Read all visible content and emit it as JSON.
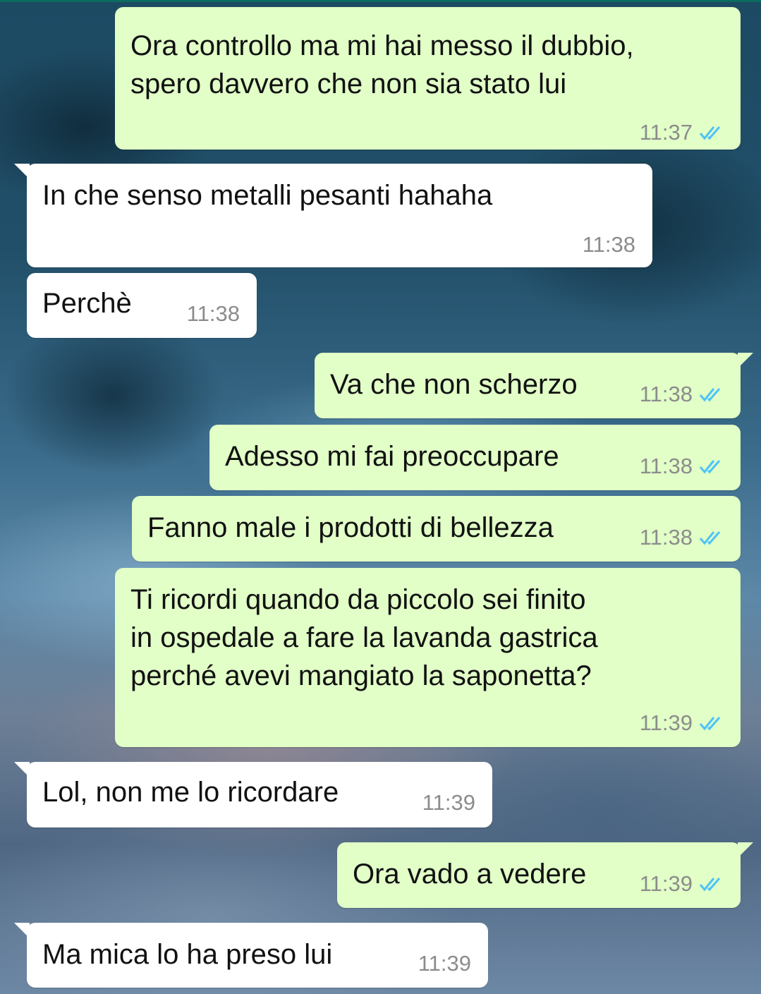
{
  "colors": {
    "outgoing_bubble": "#e1ffc7",
    "incoming_bubble": "#ffffff",
    "read_ticks": "#4fc3f7",
    "time_text": "#8c8c8c"
  },
  "messages": [
    {
      "direction": "out",
      "text": "Ora controllo ma mi hai messo il dubbio,\nspero davvero che non sia stato lui",
      "time": "11:37",
      "status": "read"
    },
    {
      "direction": "in",
      "text": "In che senso metalli pesanti hahaha",
      "time": "11:38"
    },
    {
      "direction": "in",
      "text": "Perchè",
      "time": "11:38"
    },
    {
      "direction": "out",
      "text": "Va che non scherzo",
      "time": "11:38",
      "status": "read"
    },
    {
      "direction": "out",
      "text": "Adesso mi fai preoccupare",
      "time": "11:38",
      "status": "read"
    },
    {
      "direction": "out",
      "text": "Fanno male i prodotti di bellezza",
      "time": "11:38",
      "status": "read"
    },
    {
      "direction": "out",
      "text": "Ti ricordi quando da piccolo sei finito\nin ospedale a fare la lavanda gastrica\nperché avevi mangiato la saponetta?",
      "time": "11:39",
      "status": "read"
    },
    {
      "direction": "in",
      "text": "Lol, non me lo ricordare",
      "time": "11:39"
    },
    {
      "direction": "out",
      "text": "Ora vado a vedere",
      "time": "11:39",
      "status": "read"
    },
    {
      "direction": "in",
      "text": "Ma mica lo ha preso lui",
      "time": "11:39"
    }
  ]
}
